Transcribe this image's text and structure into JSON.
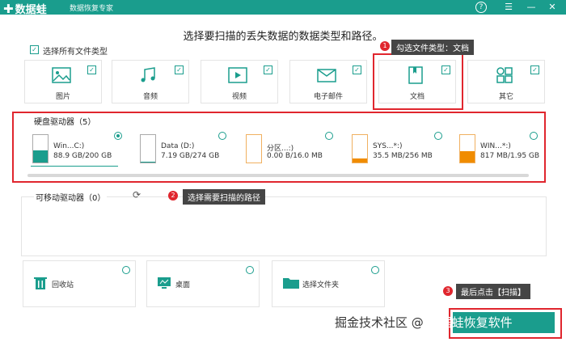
{
  "colors": {
    "accent": "#1a9d8d",
    "annotation_red": "#e0262e",
    "callout_bg": "#454545",
    "fill_blue": "#1a9d8d",
    "fill_orange": "#f08c00"
  },
  "titlebar": {
    "app_name": "数据蛙",
    "subtitle": "数据恢复专家",
    "icons": [
      "help-icon",
      "menu-icon",
      "minimize-icon",
      "close-icon"
    ]
  },
  "main": {
    "title": "选择要扫描的丢失数据的数据类型和路径。",
    "select_all_label": "选择所有文件类型"
  },
  "file_types": [
    {
      "label": "图片",
      "icon": "image-icon",
      "checked": true
    },
    {
      "label": "音频",
      "icon": "audio-icon",
      "checked": true
    },
    {
      "label": "视频",
      "icon": "video-icon",
      "checked": true
    },
    {
      "label": "电子邮件",
      "icon": "email-icon",
      "checked": true
    },
    {
      "label": "文档",
      "icon": "document-icon",
      "checked": true
    },
    {
      "label": "其它",
      "icon": "other-icon",
      "checked": true
    }
  ],
  "hard_drives": {
    "title": "硬盘驱动器（5）",
    "items": [
      {
        "name": "Win...C:)",
        "size": "88.9 GB/200 GB",
        "used_fraction": 0.44,
        "selected": true
      },
      {
        "name": "Data (D:)",
        "size": "7.19 GB/274 GB",
        "used_fraction": 0.03,
        "selected": false
      },
      {
        "name": "分区...:)",
        "size": "0.00  B/16.0 MB",
        "used_fraction": 0.0,
        "selected": false
      },
      {
        "name": "SYS...*:)",
        "size": "35.5 MB/256 MB",
        "used_fraction": 0.14,
        "selected": false
      },
      {
        "name": "WIN...*:)",
        "size": "817 MB/1.95 GB",
        "used_fraction": 0.42,
        "selected": false
      }
    ]
  },
  "removable": {
    "title": "可移动驱动器（0）"
  },
  "locations": [
    {
      "label": "回收站",
      "icon": "recycle-bin-icon"
    },
    {
      "label": "桌面",
      "icon": "desktop-icon"
    },
    {
      "label": "选择文件夹",
      "icon": "folder-icon"
    }
  ],
  "annotations": [
    {
      "num": "1",
      "text": "勾选文件类型：文档"
    },
    {
      "num": "2",
      "text": "选择需要扫描的路径"
    },
    {
      "num": "3",
      "text": "最后点击【扫描】"
    }
  ],
  "watermark": {
    "prefix": "掘金技术社区 @",
    "suffix": "数据蛙恢复软件"
  }
}
